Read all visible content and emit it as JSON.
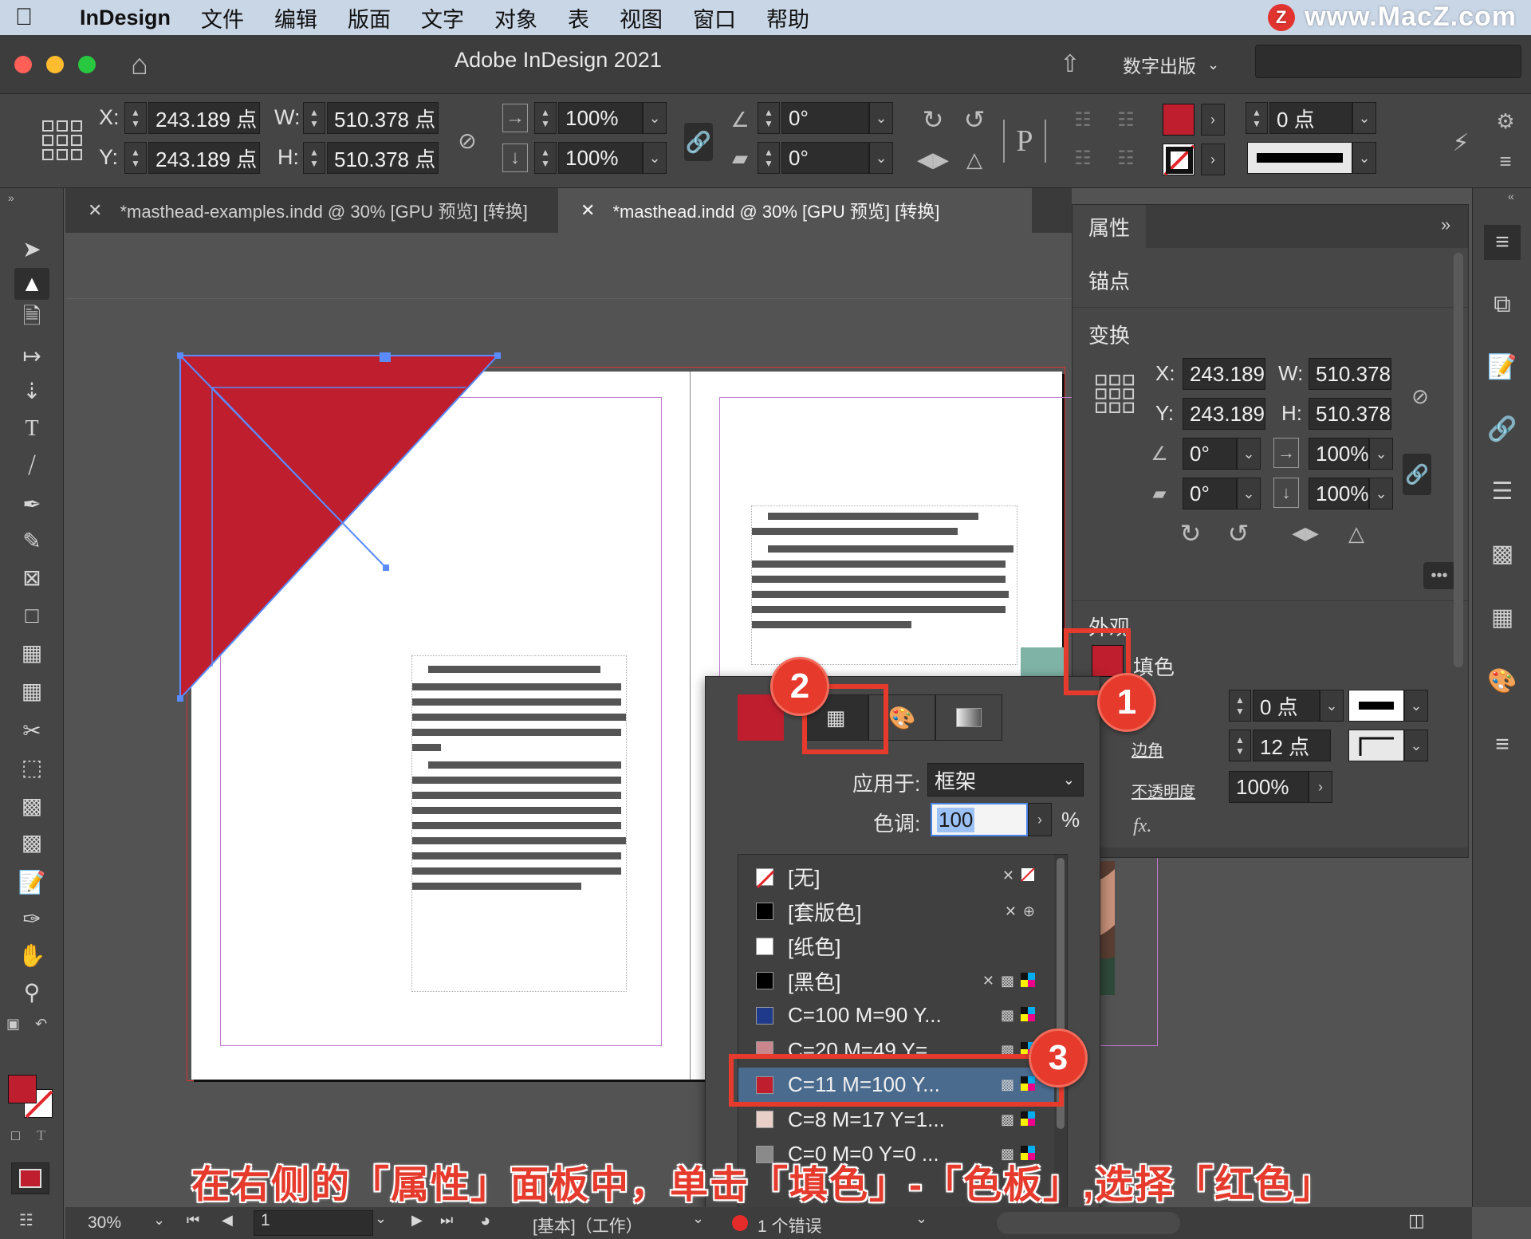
{
  "menubar": {
    "app_name": "InDesign",
    "items": [
      "文件",
      "编辑",
      "版面",
      "文字",
      "对象",
      "表",
      "视图",
      "窗口",
      "帮助"
    ],
    "watermark": "www.MacZ.com",
    "watermark_logo": "Z"
  },
  "titlebar": {
    "title": "Adobe InDesign 2021",
    "workspace": "数字出版"
  },
  "control": {
    "x_label": "X:",
    "x_value": "243.189 点",
    "y_label": "Y:",
    "y_value": "243.189 点",
    "w_label": "W:",
    "w_value": "510.378 点",
    "h_label": "H:",
    "h_value": "510.378 点",
    "scale_x": "100%",
    "scale_y": "100%",
    "rotate": "0°",
    "shear": "0°",
    "stroke_weight": "0 点",
    "p_glyph": "P"
  },
  "tabs": [
    {
      "label": "*masthead-examples.indd @ 30% [GPU 预览] [转换]"
    },
    {
      "label": "*masthead.indd @ 30% [GPU 预览] [转换]"
    }
  ],
  "properties": {
    "tab_title": "属性",
    "section_anchor": "锚点",
    "section_transform": "变换",
    "x_label": "X:",
    "x_value": "243.189",
    "y_label": "Y:",
    "y_value": "243.189",
    "w_label": "W:",
    "w_value": "510.378",
    "h_label": "H:",
    "h_value": "510.378",
    "rotate": "0°",
    "shear": "0°",
    "scale_x": "100%",
    "scale_y": "100%",
    "section_appearance": "外观",
    "fill_label": "填色",
    "stroke_weight": "0 点",
    "corner_label": "边角",
    "corner_value": "12 点",
    "opacity_label": "不透明度",
    "opacity_value": "100%",
    "fx_label": "fx."
  },
  "swatch_popup": {
    "apply_label": "应用于:",
    "apply_value": "框架",
    "tint_label": "色调:",
    "tint_value": "100",
    "tint_unit": "%",
    "swatches": [
      {
        "name": "[无]",
        "color": "none"
      },
      {
        "name": "[套版色]",
        "color": "#000000"
      },
      {
        "name": "[纸色]",
        "color": "#ffffff"
      },
      {
        "name": "[黑色]",
        "color": "#000000"
      },
      {
        "name": "C=100 M=90 Y...",
        "color": "#1f3a8a"
      },
      {
        "name": "C=20 M=49 Y=...",
        "color": "#c9868d"
      },
      {
        "name": "C=11 M=100 Y...",
        "color": "#be1e2d"
      },
      {
        "name": "C=8 M=17 Y=1...",
        "color": "#e8cfc8"
      },
      {
        "name": "C=0 M=0 Y=0 ...",
        "color": "#8a8a8a"
      }
    ],
    "selected_index": 6
  },
  "callouts": [
    "1",
    "2",
    "3"
  ],
  "statusbar": {
    "zoom": "30%",
    "page": "1",
    "profile": "[基本]（工作）",
    "errors": "1 个错误"
  },
  "caption": "在右侧的「属性」面板中，单击「填色」-「色板」,选择「红色」",
  "colors": {
    "fill_red": "#be1e2d",
    "accent_callout": "#e53a2c",
    "panel_bg": "#474747",
    "canvas_bg": "#535353"
  }
}
